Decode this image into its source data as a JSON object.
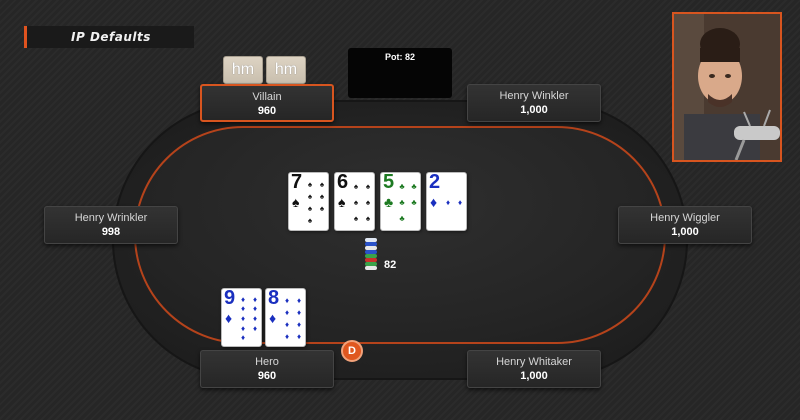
{
  "banner": {
    "title": "IP Defaults"
  },
  "pot": {
    "label": "Pot: 82",
    "amount": "82"
  },
  "dealer": {
    "label": "D"
  },
  "villain_cards": [
    "hm",
    "hm"
  ],
  "seats": {
    "villain": {
      "name": "Villain",
      "stack": "960"
    },
    "top_right": {
      "name": "Henry Winkler",
      "stack": "1,000"
    },
    "left": {
      "name": "Henry Wrinkler",
      "stack": "998"
    },
    "right": {
      "name": "Henry Wiggler",
      "stack": "1,000"
    },
    "hero": {
      "name": "Hero",
      "stack": "960"
    },
    "bottom_right": {
      "name": "Henry Whitaker",
      "stack": "1,000"
    }
  },
  "board": [
    {
      "rank": "7",
      "suit": "♠",
      "color": "black"
    },
    {
      "rank": "6",
      "suit": "♠",
      "color": "black"
    },
    {
      "rank": "5",
      "suit": "♣",
      "color": "green"
    },
    {
      "rank": "2",
      "suit": "♦",
      "color": "blue"
    }
  ],
  "hero_cards": [
    {
      "rank": "9",
      "suit": "♦",
      "color": "blue"
    },
    {
      "rank": "8",
      "suit": "♦",
      "color": "blue"
    }
  ],
  "colors": {
    "accent": "#d8551f",
    "felt": "#242424",
    "diamond": "#1a2fbf",
    "club": "#1d7a22",
    "spade": "#111111"
  }
}
